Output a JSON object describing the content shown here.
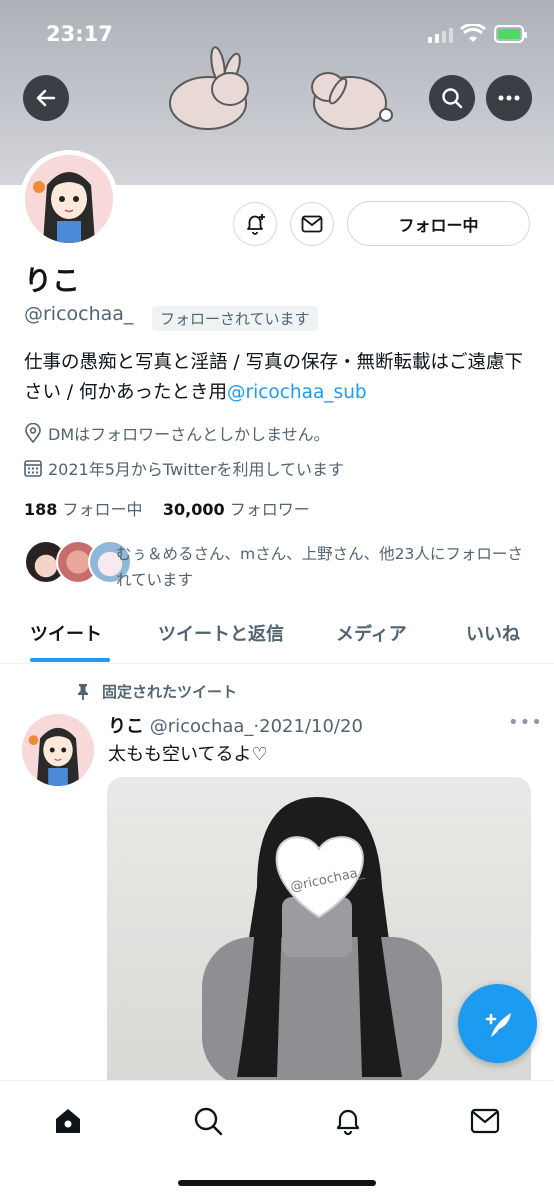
{
  "status_bar": {
    "time": "23:17"
  },
  "profile": {
    "name": "りこ",
    "handle": "@ricochaa_",
    "follows_you": "フォローされています",
    "follow_button": "フォロー中",
    "bio_text": "仕事の愚痴と写真と淫語 / 写真の保存・無断転載はご遠慮下さい / 何かあったとき用",
    "bio_mention": "@ricochaa_sub",
    "location": "DMはフォロワーさんとしかしません。",
    "joined": "2021年5月からTwitterを利用しています",
    "following_count": "188",
    "following_label": "フォロー中",
    "followers_count": "30,000",
    "followers_label": "フォロワー",
    "followers_you_know": "むぅ＆めるさん、mさん、上野さん、他23人にフォローされています"
  },
  "tabs": [
    {
      "label": "ツイート"
    },
    {
      "label": "ツイートと返信"
    },
    {
      "label": "メディア"
    },
    {
      "label": "いいね"
    }
  ],
  "tweet": {
    "pinned_label": "固定されたツイート",
    "name": "りこ",
    "handle": "@ricochaa_",
    "date": "2021/10/20",
    "separator": "·",
    "text": "太もも空いてるよ♡",
    "more": "•••",
    "image_watermark": "@ricochaa_"
  },
  "icons": {
    "back": "arrow-left-icon",
    "search": "search-icon",
    "more": "more-icon",
    "notify": "bell-plus-icon",
    "message": "mail-icon",
    "location": "location-pin-icon",
    "calendar": "calendar-icon",
    "pin": "pin-icon",
    "compose": "compose-feather-icon",
    "nav_home": "home-icon",
    "nav_search": "search-icon",
    "nav_notifications": "bell-icon",
    "nav_messages": "mail-icon"
  },
  "colors": {
    "accent": "#1d9bf0",
    "text": "#0f1419",
    "secondary": "#536471"
  }
}
